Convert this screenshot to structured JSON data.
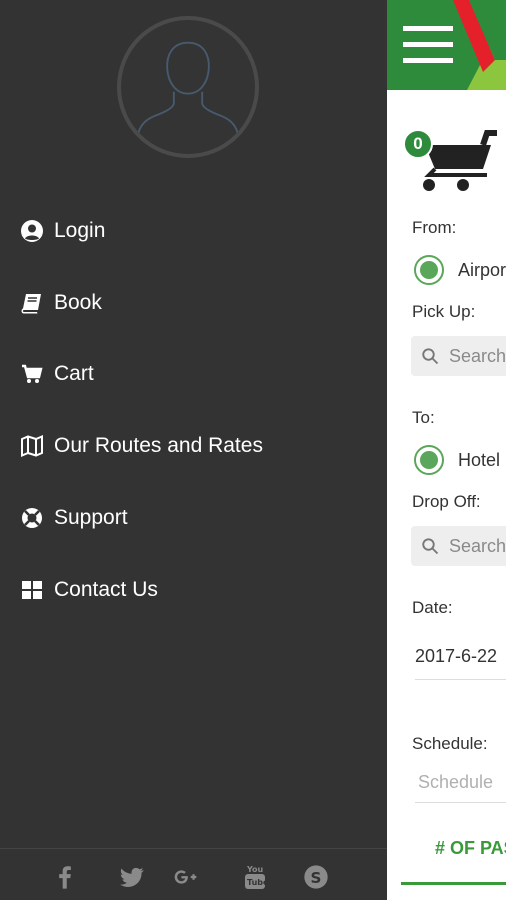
{
  "drawer": {
    "menu": [
      {
        "label": "Login",
        "icon": "user-circle-icon"
      },
      {
        "label": "Book",
        "icon": "book-icon"
      },
      {
        "label": "Cart",
        "icon": "cart-icon"
      },
      {
        "label": "Our Routes and Rates",
        "icon": "map-icon"
      },
      {
        "label": "Support",
        "icon": "life-ring-icon"
      },
      {
        "label": "Contact Us",
        "icon": "windows-icon"
      }
    ],
    "social": [
      "facebook-icon",
      "twitter-icon",
      "google-plus-icon",
      "youtube-icon",
      "skype-icon"
    ]
  },
  "panel": {
    "cart_count": "0",
    "from_label": "From:",
    "from_option": "Airport",
    "pickup_label": "Pick Up:",
    "pickup_placeholder": "Search",
    "to_label": "To:",
    "to_option": "Hotel",
    "dropoff_label": "Drop Off:",
    "dropoff_placeholder": "Search",
    "date_label": "Date:",
    "date_value": "2017-6-22",
    "schedule_label": "Schedule:",
    "schedule_placeholder": "Schedule",
    "tab_label": "# OF PASSENGERS"
  },
  "colors": {
    "drawer_bg": "#333333",
    "brand_green": "#2e8b3b",
    "accent_red": "#e4202a",
    "lime": "#8cc63f",
    "radio_green": "#5aa65a"
  }
}
